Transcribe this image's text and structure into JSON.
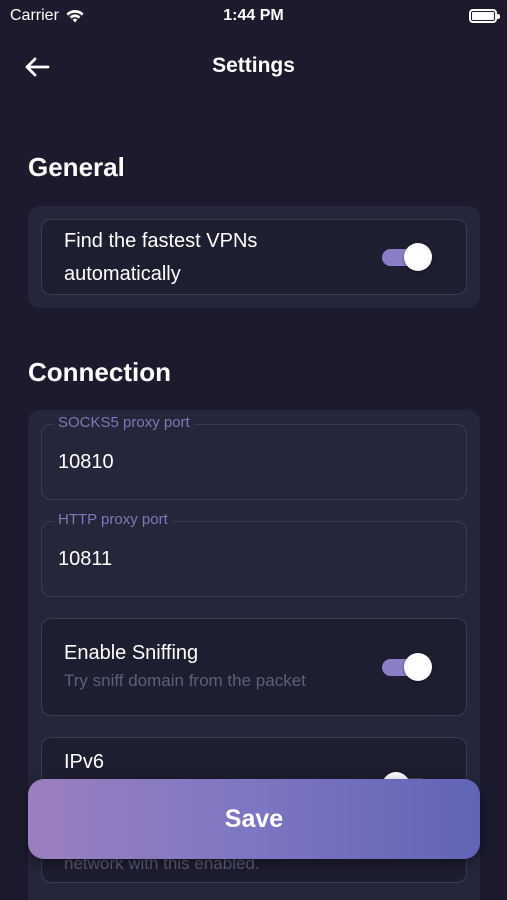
{
  "status_bar": {
    "carrier": "Carrier",
    "time": "1:44 PM"
  },
  "header": {
    "title": "Settings"
  },
  "general": {
    "title": "General",
    "fastest": {
      "line1": "Find the fastest VPNs",
      "line2": "automatically",
      "enabled": true
    }
  },
  "connection": {
    "title": "Connection",
    "socks5": {
      "label": "SOCKS5 proxy port",
      "value": "10810"
    },
    "http": {
      "label": "HTTP proxy port",
      "value": "10811"
    },
    "sniffing": {
      "label": "Enable Sniffing",
      "sub": "Try sniff domain from the packet",
      "enabled": true
    },
    "ipv6": {
      "label": "IPv6",
      "sub": "network with this enabled.",
      "enabled": false
    }
  },
  "save_label": "Save"
}
